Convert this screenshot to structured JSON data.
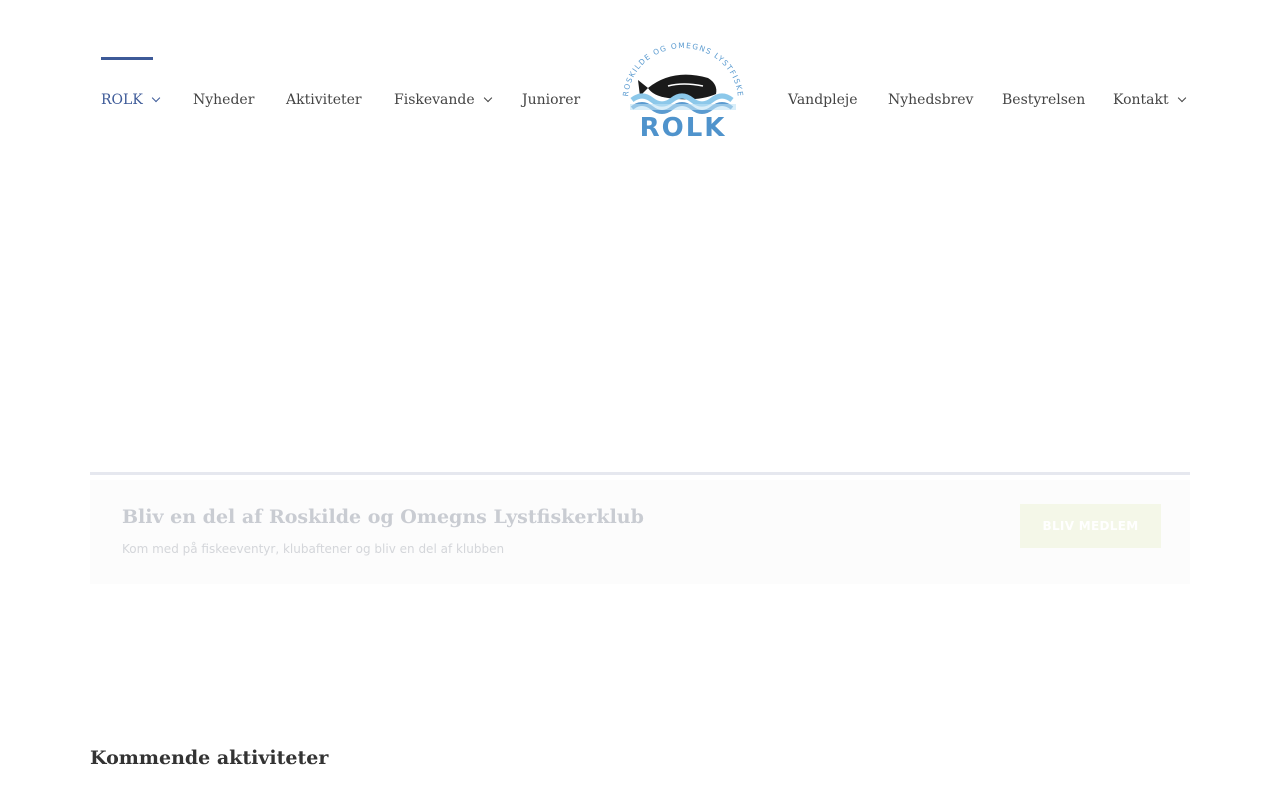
{
  "nav_left": [
    {
      "label": "ROLK",
      "dropdown": true,
      "active": true
    },
    {
      "label": "Nyheder",
      "dropdown": false
    },
    {
      "label": "Aktiviteter",
      "dropdown": false
    },
    {
      "label": "Fiskevande",
      "dropdown": true
    },
    {
      "label": "Juniorer",
      "dropdown": false
    }
  ],
  "nav_right": [
    {
      "label": "Vandpleje",
      "dropdown": false
    },
    {
      "label": "Nyhedsbrev",
      "dropdown": false
    },
    {
      "label": "Bestyrelsen",
      "dropdown": false
    },
    {
      "label": "Kontakt",
      "dropdown": true
    }
  ],
  "logo": {
    "ring_text": "ROSKILDE OG OMEGNS LYSTFISKER KLUB",
    "wordmark": "ROLK"
  },
  "cta": {
    "title": "Bliv en del af Roskilde og Omegns Lystfiskerklub",
    "subtitle": "Kom med på fiskeeventyr, klubaftener og bliv en del af klubben",
    "button": "BLIV MEDLEM"
  },
  "upcoming_title": "Kommende aktiviteter",
  "colors": {
    "accent": "#3d5a98",
    "logo_blue": "#5b9bd0",
    "logo_wave": "#8cc8ea"
  }
}
